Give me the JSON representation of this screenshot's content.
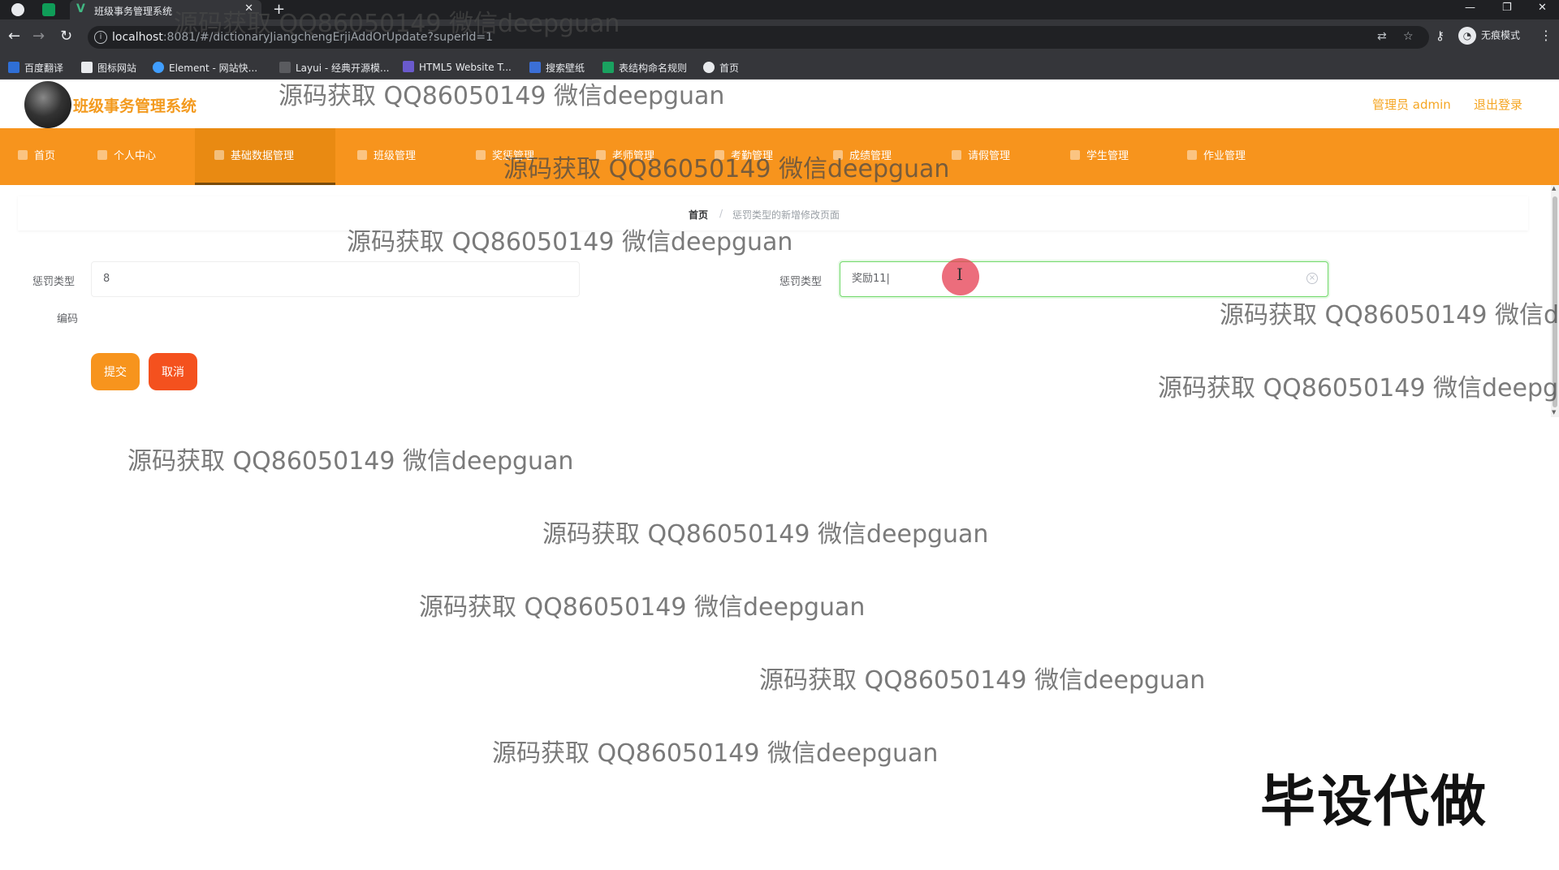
{
  "browser": {
    "tab_title": "班级事务管理系统",
    "url_host": "localhost",
    "url_path": ":8081/#/dictionaryJiangchengErjiAddOrUpdate?superId=1",
    "incognito_label": "无痕模式",
    "bookmarks": [
      "百度翻译",
      "图标网站",
      "Element - 网站快...",
      "Layui - 经典开源模...",
      "HTML5 Website T...",
      "搜索壁纸",
      "表结构命名规则",
      "首页"
    ]
  },
  "header": {
    "system_title": "班级事务管理系统",
    "admin_label": "管理员 admin",
    "logout_label": "退出登录"
  },
  "menu": {
    "items": [
      "首页",
      "个人中心",
      "基础数据管理",
      "班级管理",
      "奖惩管理",
      "老师管理",
      "考勤管理",
      "成绩管理",
      "请假管理",
      "学生管理",
      "作业管理"
    ],
    "active": "基础数据管理",
    "accent_color": "#f7941d"
  },
  "breadcrumb": {
    "home": "首页",
    "separator": "/",
    "current": "惩罚类型的新增修改页面"
  },
  "form": {
    "code_label_line1": "惩罚类型",
    "code_label_line2": "编码",
    "code_value": "8",
    "name_label": "惩罚类型",
    "name_value": "奖励11|",
    "submit_label": "提交",
    "cancel_label": "取消"
  },
  "overlay": {
    "watermark_text": "源码获取 QQ86050149 微信deepguan",
    "stamp_text": "毕设代做"
  }
}
